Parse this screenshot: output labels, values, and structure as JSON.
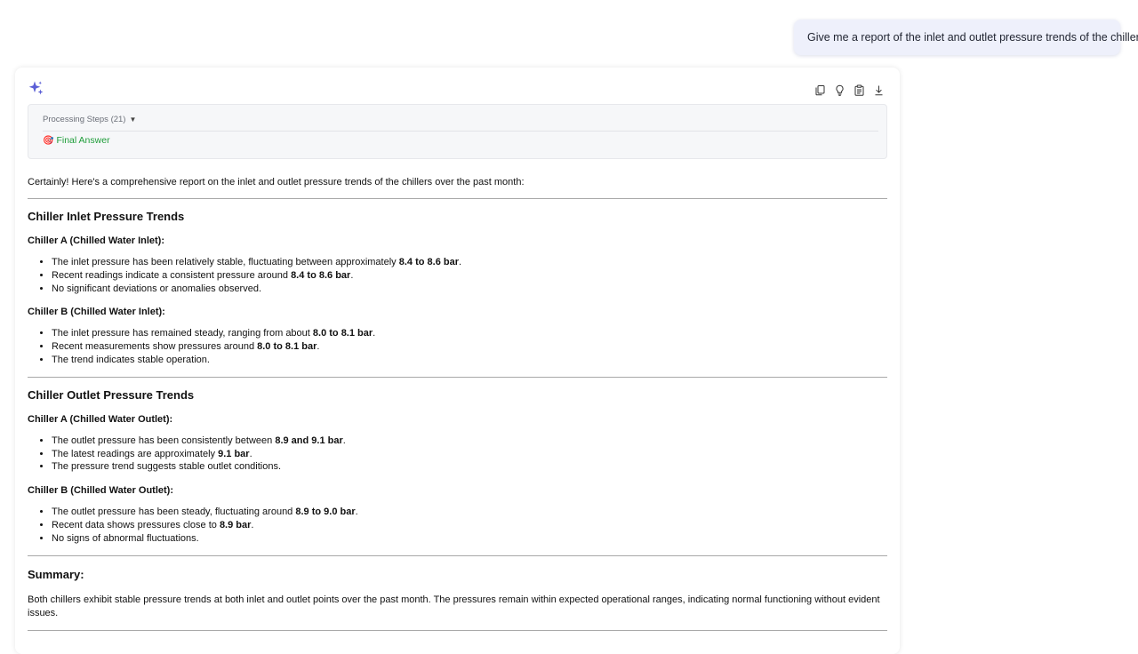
{
  "user_message": "Give me a report of the inlet and outlet pressure trends of the chillers.",
  "assistant": {
    "icon": "sparkle-icon",
    "toolbar": [
      "copy-icon",
      "lightbulb-icon",
      "clipboard-icon",
      "download-icon"
    ],
    "processing_steps": {
      "label": "Processing Steps (21)",
      "caret": "▼",
      "final_answer_label": "Final Answer",
      "final_answer_icon": "🎯"
    },
    "intro": "Certainly! Here's a comprehensive report on the inlet and outlet pressure trends of the chillers over the past month:",
    "sections": [
      {
        "title": "Chiller Inlet Pressure Trends",
        "subsections": [
          {
            "title": "Chiller A (Chilled Water Inlet):",
            "items": [
              {
                "pre": "The inlet pressure has been relatively stable, fluctuating between approximately ",
                "bold": "8.4 to 8.6 bar",
                "post": "."
              },
              {
                "pre": "Recent readings indicate a consistent pressure around ",
                "bold": "8.4 to 8.6 bar",
                "post": "."
              },
              {
                "pre": "No significant deviations or anomalies observed.",
                "bold": "",
                "post": ""
              }
            ]
          },
          {
            "title": "Chiller B (Chilled Water Inlet):",
            "items": [
              {
                "pre": "The inlet pressure has remained steady, ranging from about ",
                "bold": "8.0 to 8.1 bar",
                "post": "."
              },
              {
                "pre": "Recent measurements show pressures around ",
                "bold": "8.0 to 8.1 bar",
                "post": "."
              },
              {
                "pre": "The trend indicates stable operation.",
                "bold": "",
                "post": ""
              }
            ]
          }
        ]
      },
      {
        "title": "Chiller Outlet Pressure Trends",
        "subsections": [
          {
            "title": "Chiller A (Chilled Water Outlet):",
            "items": [
              {
                "pre": "The outlet pressure has been consistently between ",
                "bold": "8.9 and 9.1 bar",
                "post": "."
              },
              {
                "pre": "The latest readings are approximately ",
                "bold": "9.1 bar",
                "post": "."
              },
              {
                "pre": "The pressure trend suggests stable outlet conditions.",
                "bold": "",
                "post": ""
              }
            ]
          },
          {
            "title": "Chiller B (Chilled Water Outlet):",
            "items": [
              {
                "pre": "The outlet pressure has been steady, fluctuating around ",
                "bold": "8.9 to 9.0 bar",
                "post": "."
              },
              {
                "pre": "Recent data shows pressures close to ",
                "bold": "8.9 bar",
                "post": "."
              },
              {
                "pre": "No signs of abnormal fluctuations.",
                "bold": "",
                "post": ""
              }
            ]
          }
        ]
      }
    ],
    "summary": {
      "title": "Summary:",
      "text": "Both chillers exhibit stable pressure trends at both inlet and outlet points over the past month. The pressures remain within expected operational ranges, indicating normal functioning without evident issues."
    }
  }
}
